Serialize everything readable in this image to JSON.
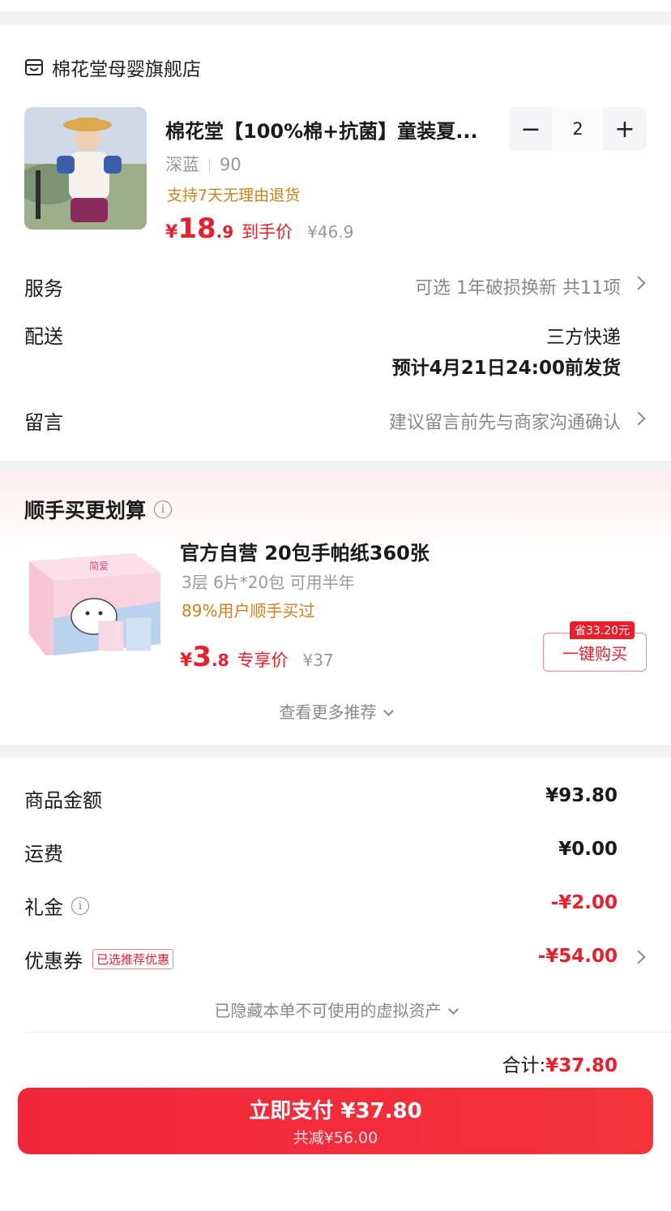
{
  "store": {
    "name": "棉花堂母婴旗舰店"
  },
  "product": {
    "title": "棉花堂【100%棉+抗菌】童装夏...",
    "color": "深蓝",
    "size": "90",
    "return_policy": "支持7天无理由退货",
    "price_currency": "¥",
    "price_int": "18",
    "price_dec": ".9",
    "price_label": "到手价",
    "original_price": "¥46.9",
    "quantity": "2",
    "minus": "−",
    "plus": "+"
  },
  "service": {
    "label": "服务",
    "value": "可选 1年破损换新 共11项"
  },
  "delivery": {
    "label": "配送",
    "method": "三方快递",
    "eta": "预计4月21日24:00前发货"
  },
  "message": {
    "label": "留言",
    "placeholder": "建议留言前先与商家沟通确认"
  },
  "recommend": {
    "title": "顺手买更划算",
    "info": "i",
    "name": "官方自营 20包手帕纸360张",
    "spec": "3层 6片*20包 可用半年",
    "bought": "89%用户顺手买过",
    "price_currency": "¥",
    "price_int": "3",
    "price_dec": ".8",
    "price_label": "专享价",
    "original_price": "¥37",
    "save_tag": "省33.20元",
    "buy_label": "一键购买",
    "more": "查看更多推荐",
    "image_brand": "简爱"
  },
  "summary": {
    "goods_label": "商品金额",
    "goods_value": "¥93.80",
    "shipping_label": "运费",
    "shipping_value": "¥0.00",
    "gift_label": "礼金",
    "gift_info": "i",
    "gift_value": "-¥2.00",
    "coupon_label": "优惠券",
    "coupon_tag": "已选推荐优惠",
    "coupon_value": "-¥54.00",
    "hidden_assets": "已隐藏本单不可使用的虚拟资产",
    "total_label": "合计:",
    "total_value": "¥37.80"
  },
  "pay": {
    "label": "立即支付 ¥37.80",
    "sub": "共减¥56.00"
  },
  "colors": {
    "accent": "#e8202b",
    "orange": "#c8821e",
    "muted": "#888888"
  }
}
